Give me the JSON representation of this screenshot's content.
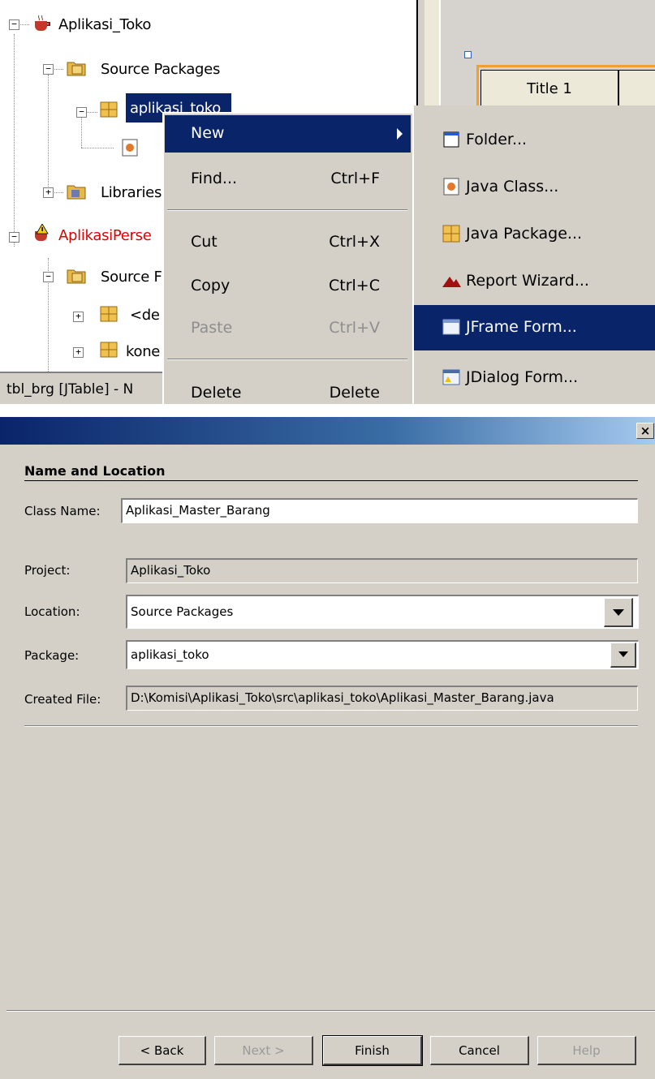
{
  "tree": {
    "project1": "Aplikasi_Toko",
    "source_packages": "Source Packages",
    "package_selected": "aplikasi_toko",
    "libraries": "Libraries",
    "project2": "AplikasiPerse",
    "source_packages2": "Source F",
    "pkg_default": "<de",
    "pkg_koneksi": "kone",
    "expand_minus": "−",
    "expand_plus": "+"
  },
  "designer": {
    "column1": "Title 1"
  },
  "status": {
    "text": "tbl_brg [JTable] - N"
  },
  "context_menu": {
    "new": "New",
    "find": "Find...",
    "find_shortcut": "Ctrl+F",
    "cut": "Cut",
    "cut_shortcut": "Ctrl+X",
    "copy": "Copy",
    "copy_shortcut": "Ctrl+C",
    "paste": "Paste",
    "paste_shortcut": "Ctrl+V",
    "delete": "Delete",
    "delete_shortcut": "Delete"
  },
  "submenu": {
    "folder": "Folder...",
    "java_class": "Java Class...",
    "java_package": "Java Package...",
    "report_wizard": "Report Wizard...",
    "jframe_form": "JFrame Form...",
    "jdialog_form": "JDialog Form..."
  },
  "dialog": {
    "close": "×",
    "section_title": "Name and Location",
    "class_name_label": "Class Name:",
    "class_name_value": "Aplikasi_Master_Barang",
    "project_label": "Project:",
    "project_value": "Aplikasi_Toko",
    "location_label": "Location:",
    "location_value": "Source Packages",
    "package_label": "Package:",
    "package_value": "aplikasi_toko",
    "created_file_label": "Created File:",
    "created_file_value": "D:\\Komisi\\Aplikasi_Toko\\src\\aplikasi_toko\\Aplikasi_Master_Barang.java",
    "buttons": {
      "back": "< Back",
      "next": "Next >",
      "finish": "Finish",
      "cancel": "Cancel",
      "help": "Help"
    }
  },
  "colors": {
    "selection": "#0a246a",
    "error_project": "#e00000",
    "face": "#d4d0c8"
  }
}
